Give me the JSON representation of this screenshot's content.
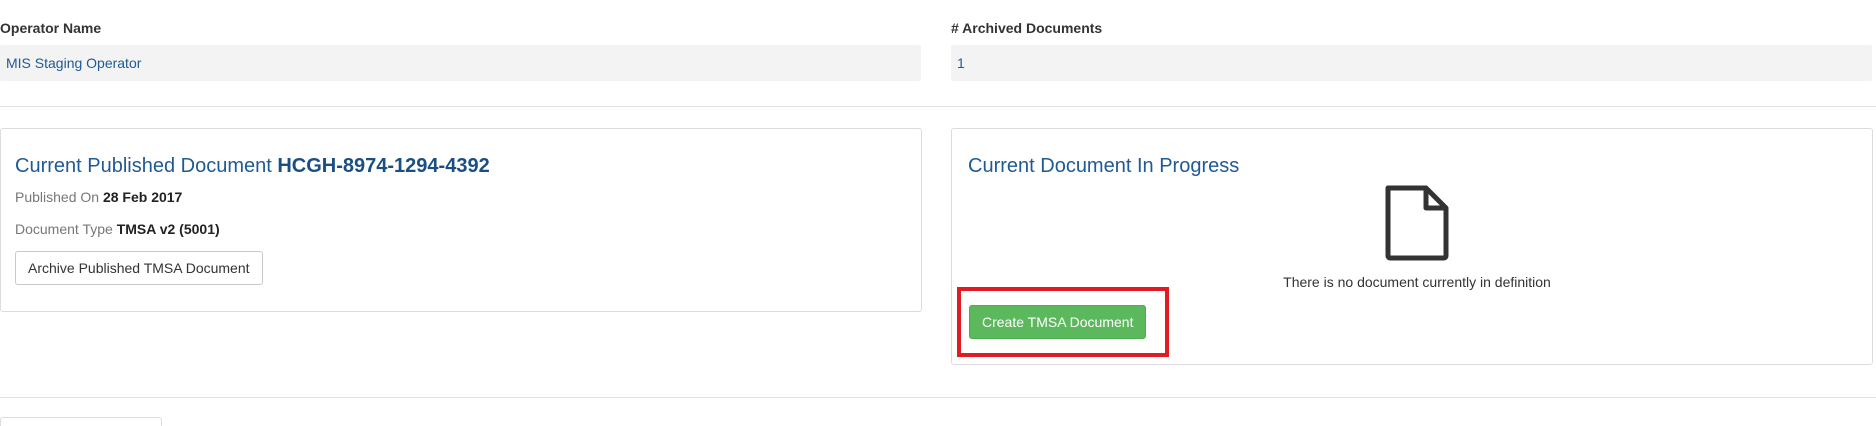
{
  "operator": {
    "label": "Operator Name",
    "value": "MIS Staging Operator"
  },
  "archived": {
    "label": "# Archived Documents",
    "value": "1"
  },
  "published_panel": {
    "title_prefix": "Current Published Document",
    "document_id": "HCGH-8974-1294-4392",
    "published_on_label": "Published On",
    "published_on_value": "28 Feb 2017",
    "doc_type_label": "Document Type",
    "doc_type_value": "TMSA v2 (5001)",
    "archive_button": "Archive Published TMSA Document"
  },
  "progress_panel": {
    "title": "Current Document In Progress",
    "empty_message": "There is no document currently in definition",
    "create_button": "Create TMSA Document",
    "icon": "file-icon"
  },
  "colors": {
    "link": "#1f5a94",
    "success": "#5cb85c",
    "highlight": "#e21a23"
  }
}
